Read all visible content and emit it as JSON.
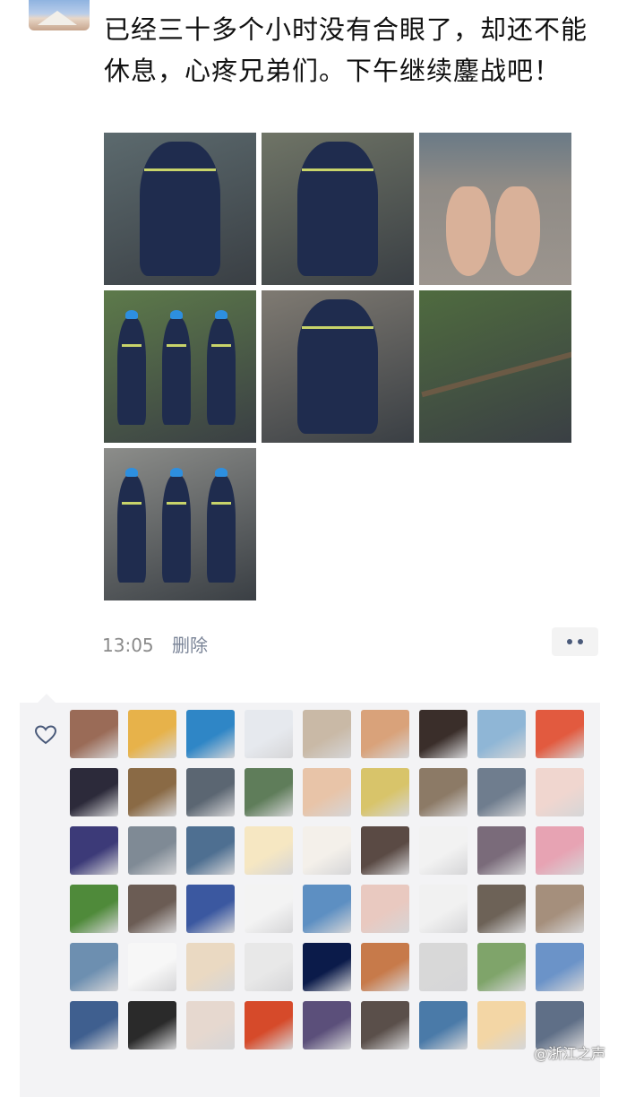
{
  "post": {
    "text": "已经三十多个小时没有合眼了，却还不能休息，心疼兄弟们。下午继续鏖战吧！",
    "time": "13:05",
    "delete_label": "删除",
    "photos": [
      {
        "name": "photo-worker-sitting-raincoat",
        "bg": "#5c6a6e"
      },
      {
        "name": "photo-worker-pouring-water-boot",
        "bg": "#6f7466"
      },
      {
        "name": "photo-bare-feet",
        "bg": "#8f8b86"
      },
      {
        "name": "photo-workers-flooded-road",
        "bg": "#5d7a4a"
      },
      {
        "name": "photo-workers-damaged-house",
        "bg": "#7f7a72"
      },
      {
        "name": "photo-fallen-tree",
        "bg": "#4f6b3f"
      },
      {
        "name": "photo-workers-cutting-tree",
        "bg": "#8c8d8a"
      }
    ]
  },
  "likes": {
    "heart_icon": "heart-outline-icon",
    "avatars": [
      "#9a6b57",
      "#e7b24a",
      "#2f86c6",
      "#e6e9ee",
      "#c9b9a6",
      "#d9a27a",
      "#3a2e2a",
      "#8fb6d6",
      "#e25a3f",
      "#2c2a3a",
      "#8a6a45",
      "#5b6672",
      "#5f7d5a",
      "#e8c4a8",
      "#d8c46a",
      "#8c7a66",
      "#6f7d8e",
      "#f0d6cf",
      "#3c3a78",
      "#7f8a95",
      "#4e6f91",
      "#f6e7c2",
      "#f4f0ea",
      "#5a4a44",
      "#f2f2f2",
      "#7a6b7a",
      "#e7a3b3",
      "#4f8a3a",
      "#6b5c54",
      "#3b58a0",
      "#f3f3f3",
      "#5d8fc2",
      "#e9c9c0",
      "#f1f1f1",
      "#6d6257",
      "#a58f7c",
      "#6d8fb0",
      "#f7f7f7",
      "#ead9c2",
      "#e8e8e8",
      "#0b1b4a",
      "#c77a4a",
      "#d8d8d8",
      "#7fa46a",
      "#6b93c8",
      "#3f5f8f",
      "#2a2a2a",
      "#e6d8cf",
      "#d64a2a",
      "#5b4f7a",
      "#5a4f4a",
      "#4a7aa8",
      "#f3d6a5",
      "#5f6f87"
    ]
  },
  "watermark": "@浙江之声"
}
